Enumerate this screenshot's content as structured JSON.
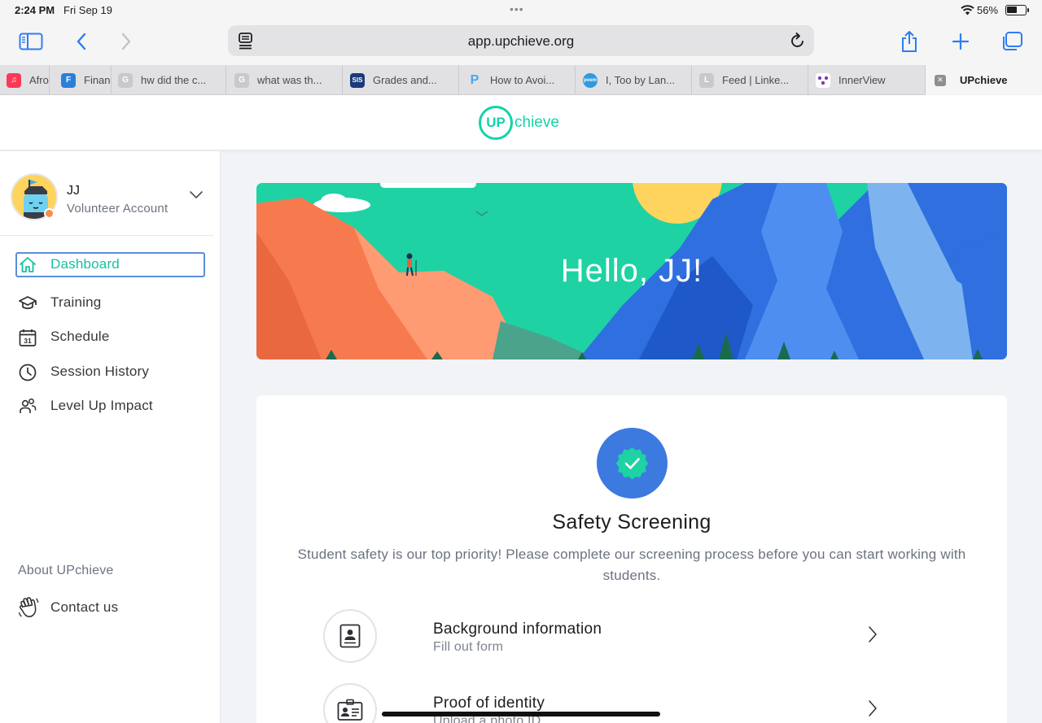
{
  "status_bar": {
    "time": "2:24 PM",
    "date": "Fri Sep 19",
    "battery_pct": "56%"
  },
  "toolbar": {
    "url": "app.upchieve.org"
  },
  "tabs": [
    {
      "label": "Afro",
      "fav_color": "#fa3a55",
      "fav_text": "♫"
    },
    {
      "label": "Finan",
      "fav_color": "#2a7fd9",
      "fav_text": "F"
    },
    {
      "label": "hw did the c...",
      "fav_color": "#c9c9cc",
      "fav_text": "G"
    },
    {
      "label": "what was th...",
      "fav_color": "#c9c9cc",
      "fav_text": "G"
    },
    {
      "label": "Grades and...",
      "fav_color": "#1a3a7a",
      "fav_text": "SIS"
    },
    {
      "label": "How to Avoi...",
      "fav_color": "#4aa8e8",
      "fav_text": "P"
    },
    {
      "label": "I, Too by Lan...",
      "fav_color": "#2d9be0",
      "fav_text": "poem"
    },
    {
      "label": "Feed | Linke...",
      "fav_color": "#c9c9cc",
      "fav_text": "L"
    },
    {
      "label": "InnerView",
      "fav_color": "#ffffff",
      "fav_text": ""
    },
    {
      "label": "UPchieve",
      "fav_color": "#8e8e93",
      "fav_text": "✕"
    }
  ],
  "brand": {
    "logo_circle": "UP",
    "logo_rest": "chieve",
    "accent": "#16d2aa"
  },
  "profile": {
    "name": "JJ",
    "role": "Volunteer Account"
  },
  "nav": [
    {
      "label": "Dashboard",
      "icon": "home-icon"
    },
    {
      "label": "Training",
      "icon": "graduation-cap-icon"
    },
    {
      "label": "Schedule",
      "icon": "calendar-icon"
    },
    {
      "label": "Session History",
      "icon": "clock-icon"
    },
    {
      "label": "Level Up Impact",
      "icon": "people-icon"
    }
  ],
  "calendar_day": "31",
  "footer_links": {
    "about": "About UPchieve",
    "contact": "Contact us"
  },
  "banner": {
    "greeting": "Hello, JJ!"
  },
  "screening": {
    "title": "Safety Screening",
    "description": "Student safety is our top priority! Please complete our screening process before you can start working with students.",
    "steps": [
      {
        "title": "Background information",
        "subtitle": "Fill out form",
        "icon": "form-icon"
      },
      {
        "title": "Proof of identity",
        "subtitle": "Upload a photo ID",
        "icon": "id-card-icon"
      }
    ]
  }
}
